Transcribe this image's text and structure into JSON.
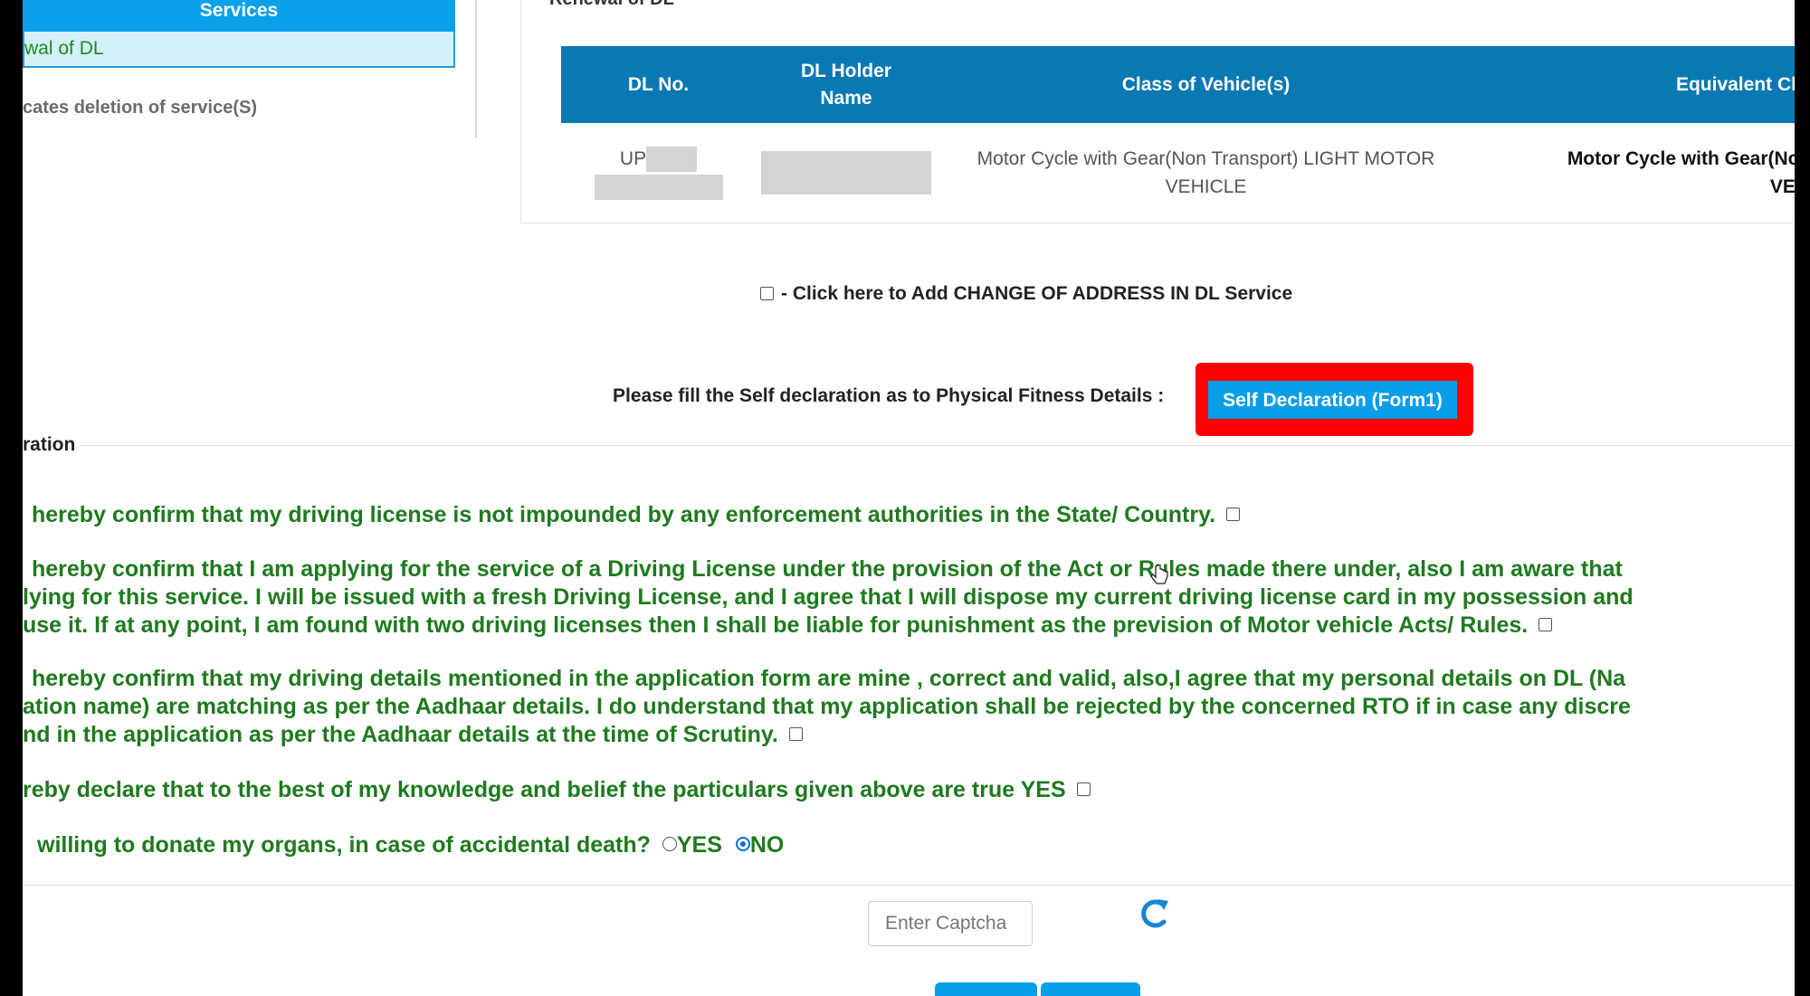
{
  "services": {
    "header": "Services",
    "item": "wal of DL",
    "note": "cates deletion of service(S)"
  },
  "renewal": {
    "legend": "Renewal of DL",
    "table": {
      "headers": [
        "DL No.",
        "DL Holder Name",
        "Class of Vehicle(s)",
        "Equivalent Class"
      ],
      "row": {
        "dl_prefix": "UP",
        "class_of_vehicle": "Motor Cycle with Gear(Non Transport) LIGHT MOTOR VEHICLE",
        "equivalent_line1": "Motor Cycle with Gear(Non T",
        "equivalent_line2": "VEHIC"
      }
    }
  },
  "change_address": {
    "label": "- Click here to Add CHANGE OF ADDRESS IN DL Service"
  },
  "fitness": {
    "label": "Please fill the Self declaration as to Physical Fitness Details :",
    "button": "Self Declaration (Form1)"
  },
  "declaration": {
    "legend": "ration",
    "d1": "hereby confirm that my driving license is not impounded by any enforcement authorities in the State/ Country.",
    "d2_line1": "hereby confirm that I am applying for the service of a Driving License under the provision of the Act or Rules made there under, also I am aware that",
    "d2_line2": "lying for this service. I will be issued with a fresh Driving License, and I agree that I will dispose my current driving license card in my possession and",
    "d2_line3": "use it. If at any point, I am found with two driving licenses then I shall be liable for punishment as the prevision of Motor vehicle Acts/ Rules.",
    "d3_line1": "hereby confirm that my driving details mentioned in the application form are mine , correct and valid, also,I agree that my personal details on DL (Na",
    "d3_line2": "ation name) are matching as per the Aadhaar details. I do understand that my application shall be rejected by the concerned RTO if in case any discre",
    "d3_line3": "nd in the application as per the Aadhaar details at the time of Scrutiny.",
    "d4": "reby declare that to the best of my knowledge and belief the particulars given above are true YES",
    "organ_question": "willing to donate my organs, in case of accidental death?",
    "organ_yes": "YES",
    "organ_no": "NO",
    "organ_selected": "NO"
  },
  "captcha": {
    "placeholder": "Enter Captcha"
  },
  "colors": {
    "services_header": "#0aa0ea",
    "table_header": "#0a79b3",
    "declaration_text": "#1e7a1e",
    "highlight": "#ff0000",
    "button": "#0a9de8"
  },
  "icons": {
    "refresh": "refresh-icon",
    "cursor": "hand-cursor-icon"
  }
}
